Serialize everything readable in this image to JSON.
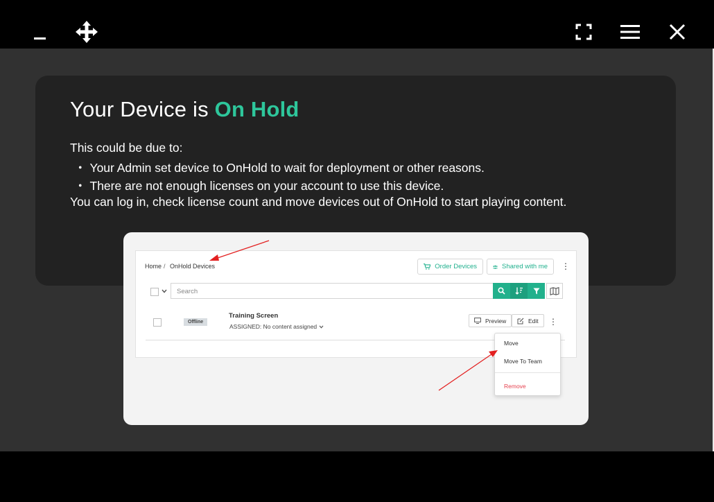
{
  "window": {
    "buttons": {
      "minimize": "minimize-icon",
      "move": "move-icon",
      "fullscreen": "fullscreen-icon",
      "menu": "hamburger-icon",
      "close": "close-icon"
    }
  },
  "content": {
    "title_prefix": "Your Device is ",
    "title_accent": "On Hold",
    "intro": "This could be due to:",
    "bullets": [
      "Your Admin set device to OnHold to wait for deployment or other reasons.",
      "There are not enough licenses on your account to use this device."
    ],
    "bullet_marker": "・",
    "outro": "You can log in, check license count and move devices out of OnHold to start playing content."
  },
  "illustration": {
    "breadcrumb": {
      "home": "Home",
      "separator": "/",
      "current": "OnHold Devices"
    },
    "order_devices": "Order Devices",
    "shared_with_me": "Shared with me",
    "search_placeholder": "Search",
    "device": {
      "status": "Offline",
      "name": "Training Screen",
      "assigned": "ASSIGNED: No content assigned"
    },
    "preview": "Preview",
    "edit": "Edit",
    "menu": {
      "move": "Move",
      "move_to_team": "Move To Team",
      "remove": "Remove"
    }
  },
  "colors": {
    "accent": "#2ec69b",
    "teal": "#22b18c",
    "danger": "#e6424f",
    "annotation_arrow": "#e32020"
  }
}
